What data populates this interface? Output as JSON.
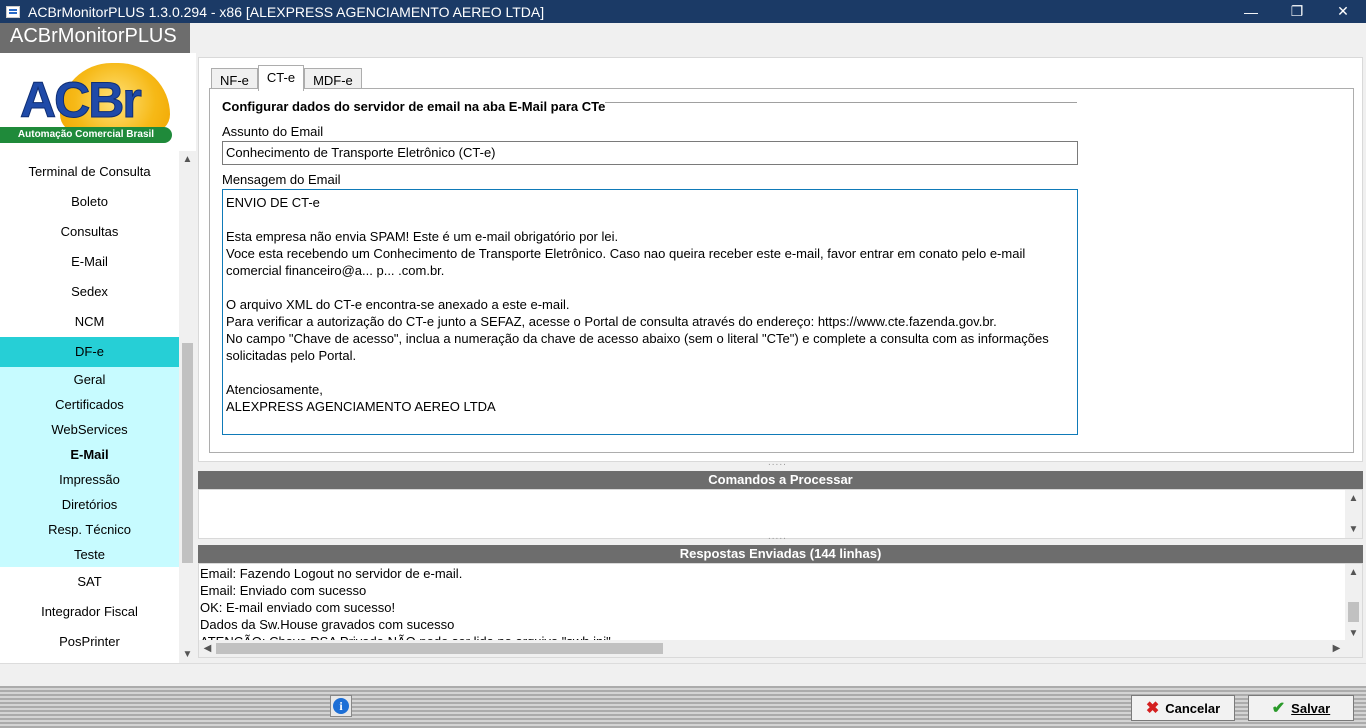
{
  "window": {
    "title": "ACBrMonitorPLUS 1.3.0.294 - x86  [ALEXPRESS AGENCIAMENTO AEREO LTDA]",
    "minimize": "—",
    "restore": "❐",
    "close": "✕"
  },
  "app_label": "ACBrMonitorPLUS",
  "logo": {
    "letters": "ACBr",
    "tagline": "Automação Comercial Brasil"
  },
  "sidebar": {
    "items_top": [
      {
        "label": "Terminal de Consulta"
      },
      {
        "label": "Boleto"
      },
      {
        "label": "Consultas"
      },
      {
        "label": "E-Mail"
      },
      {
        "label": "Sedex"
      },
      {
        "label": "NCM"
      }
    ],
    "active_section": "DF-e",
    "sub_items": [
      {
        "label": "Geral"
      },
      {
        "label": "Certificados"
      },
      {
        "label": "WebServices"
      },
      {
        "label": "E-Mail"
      },
      {
        "label": "Impressão"
      },
      {
        "label": "Diretórios"
      },
      {
        "label": "Resp. Técnico"
      },
      {
        "label": "Teste"
      }
    ],
    "items_bottom": [
      {
        "label": "SAT"
      },
      {
        "label": "Integrador Fiscal"
      },
      {
        "label": "PosPrinter"
      }
    ]
  },
  "tabs": [
    {
      "label": "NF-e"
    },
    {
      "label": "CT-e"
    },
    {
      "label": "MDF-e"
    }
  ],
  "form": {
    "section_title": "Configurar dados do servidor de email na aba E-Mail para CTe",
    "subject_label": "Assunto do Email",
    "subject_value": "Conhecimento de Transporte Eletrônico  (CT-e)",
    "message_label": "Mensagem do Email",
    "message_lines": [
      "ENVIO DE CT-e",
      "",
      "Esta empresa não envia SPAM! Este é um e-mail obrigatório por lei.",
      "Voce esta recebendo um Conhecimento de Transporte Eletrônico. Caso nao queira receber este e-mail, favor entrar em conato pelo e-mail",
      "comercial financeiro@a...  p...  .com.br.",
      "",
      "O arquivo XML do CT-e encontra-se anexado a este e-mail.",
      "Para verificar a autorização do CT-e junto a SEFAZ, acesse o Portal de consulta através do endereço: https://www.cte.fazenda.gov.br.",
      "No campo \"Chave de acesso\", inclua a numeração da chave de acesso abaixo (sem o literal \"CTe\") e complete a consulta com as informações",
      "solicitadas pelo Portal.",
      "",
      "Atenciosamente,",
      "ALEXPRESS AGENCIAMENTO AEREO LTDA"
    ]
  },
  "commands": {
    "header": "Comandos a Processar"
  },
  "responses": {
    "header": "Respostas Enviadas (144 linhas)",
    "lines": [
      "Email: Fazendo Logout no servidor de e-mail.",
      "Email: Enviado com sucesso",
      "OK: E-mail enviado com sucesso!",
      "Dados da Sw.House gravados com sucesso",
      "ATENÇÃO: Chave RSA Privada NÃO pode ser lida no arquivo \"swh.ini\""
    ]
  },
  "buttons": {
    "info": "i",
    "cancel": "Cancelar",
    "save": "Salvar"
  },
  "colors": {
    "titlebar": "#1b3a66",
    "active_section": "#26cfd6",
    "subnav_bg": "#c7fbff",
    "panel_header": "#6d6d6d",
    "cancel_icon": "#d42020",
    "save_icon": "#2a9a2a"
  }
}
